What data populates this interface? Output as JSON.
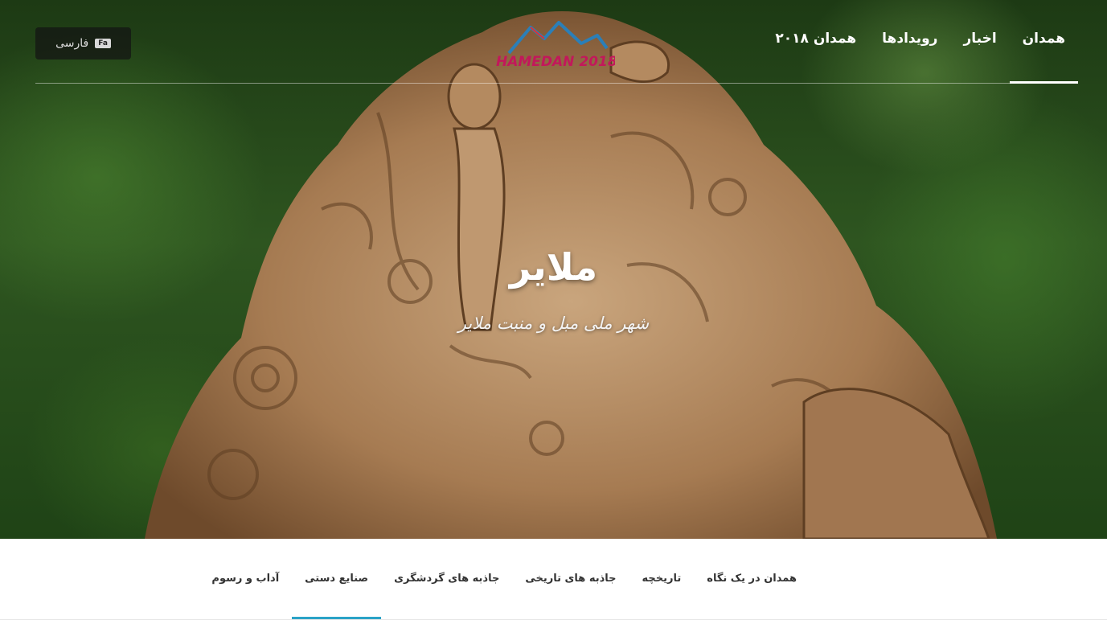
{
  "header": {
    "language": {
      "label": "فارسی",
      "badge": "Fa"
    },
    "logo_text": "HAMEDAN 2018",
    "nav": [
      {
        "label": "همدان",
        "active": true
      },
      {
        "label": "اخبار",
        "active": false
      },
      {
        "label": "رویدادها",
        "active": false
      },
      {
        "label": "همدان ۲۰۱۸",
        "active": false
      }
    ]
  },
  "hero": {
    "title": "ملایر",
    "subtitle": "شهر ملی مبل و منبت ملایر"
  },
  "subnav": {
    "tabs": [
      {
        "label": "همدان در یک نگاه",
        "active": false
      },
      {
        "label": "تاریخچه",
        "active": false
      },
      {
        "label": "جاذبه های تاریخی",
        "active": false
      },
      {
        "label": "جاذبه های گردشگری",
        "active": false
      },
      {
        "label": "صنایع دستی",
        "active": true
      },
      {
        "label": "آداب و رسوم",
        "active": false
      }
    ]
  },
  "colors": {
    "accent": "#2ba3c7",
    "wood": "#b9916a",
    "foliage": "#2e5520"
  }
}
